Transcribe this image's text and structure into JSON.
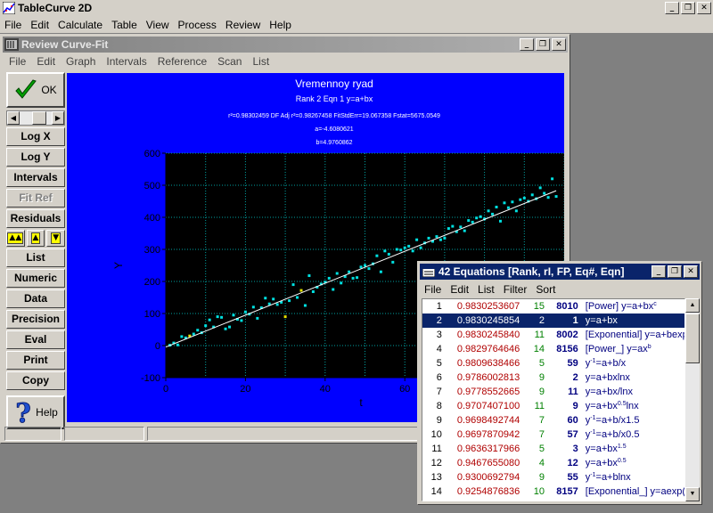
{
  "app": {
    "title": "TableCurve 2D"
  },
  "main_menu": [
    "File",
    "Edit",
    "Calculate",
    "Table",
    "View",
    "Process",
    "Review",
    "Help"
  ],
  "window_controls": {
    "minimize": "_",
    "restore": "❐",
    "close": "✕"
  },
  "review": {
    "title": "Review Curve-Fit",
    "menu": [
      "File",
      "Edit",
      "Graph",
      "Intervals",
      "Reference",
      "Scan",
      "List"
    ],
    "ok_label": "OK",
    "help_label": "Help",
    "buttons": [
      {
        "label": "Log X",
        "enabled": true
      },
      {
        "label": "Log Y",
        "enabled": true
      },
      {
        "label": "Intervals",
        "enabled": true
      },
      {
        "label": "Fit Ref",
        "enabled": false
      },
      {
        "label": "Residuals",
        "enabled": true
      }
    ],
    "buttons2": [
      {
        "label": "List"
      },
      {
        "label": "Numeric"
      },
      {
        "label": "Data"
      },
      {
        "label": "Precision"
      },
      {
        "label": "Eval"
      },
      {
        "label": "Print"
      },
      {
        "label": "Copy"
      }
    ],
    "tri_buttons": [
      "▲▲",
      "▲",
      "▼"
    ]
  },
  "colors": {
    "panel_bg": "#0000ff",
    "plot_bg": "#000000",
    "fit_line": "#ffffff",
    "points": "#00e0e0",
    "selected_row": "#0a246a"
  },
  "chart_data": {
    "type": "scatter",
    "title": "Vremennoy ryad",
    "subtitle": "Rank 2  Eqn 1  y=a+bx",
    "stats_line": "r²=0.98302459  DF Adj r²=0.98267458  FitStdErr=19.067358  Fstat=5675.0549",
    "param_a": "a=-4.6080621",
    "param_b": "b=4.9760862",
    "xlabel": "t",
    "ylabel": "Y",
    "xlim": [
      0,
      100
    ],
    "ylim": [
      -100,
      600
    ],
    "x_ticks": [
      "0",
      "20",
      "40",
      "60"
    ],
    "y_ticks": [
      "600",
      "500",
      "400",
      "300",
      "200",
      "100",
      "0",
      "-100"
    ],
    "grid": true,
    "fit": {
      "a": -4.6080621,
      "b": 4.9760862
    },
    "x": [
      1,
      2,
      3,
      4,
      5,
      6,
      7,
      8,
      9,
      10,
      11,
      12,
      13,
      14,
      15,
      16,
      17,
      18,
      19,
      20,
      21,
      22,
      23,
      24,
      25,
      26,
      27,
      28,
      29,
      30,
      31,
      32,
      33,
      34,
      35,
      36,
      37,
      38,
      39,
      40,
      41,
      42,
      43,
      44,
      45,
      46,
      47,
      48,
      49,
      50,
      51,
      52,
      53,
      54,
      55,
      56,
      57,
      58,
      59,
      60,
      61,
      62,
      63,
      64,
      65,
      66,
      67,
      68,
      69,
      70,
      71,
      72,
      73,
      74,
      75,
      76,
      77,
      78,
      79,
      80,
      81,
      82,
      83,
      84,
      85,
      86,
      87,
      88,
      89,
      90,
      91,
      92,
      93,
      94,
      95,
      96,
      97,
      98
    ],
    "y": [
      1,
      8,
      2,
      28,
      24,
      30,
      36,
      48,
      40,
      62,
      80,
      58,
      90,
      88,
      52,
      58,
      95,
      82,
      78,
      105,
      98,
      120,
      85,
      118,
      148,
      130,
      145,
      128,
      135,
      90,
      140,
      190,
      150,
      172,
      125,
      218,
      168,
      182,
      192,
      198,
      210,
      175,
      225,
      195,
      215,
      230,
      210,
      212,
      245,
      250,
      240,
      255,
      280,
      230,
      295,
      285,
      260,
      300,
      298,
      305,
      310,
      295,
      330,
      305,
      320,
      335,
      325,
      340,
      330,
      335,
      365,
      372,
      355,
      370,
      358,
      390,
      385,
      398,
      402,
      395,
      420,
      410,
      432,
      388,
      445,
      430,
      448,
      420,
      455,
      460,
      450,
      470,
      458,
      492,
      475,
      462,
      520,
      465
    ],
    "point_colors_note": "mostly cyan with a few yellow points"
  },
  "equations": {
    "title": "42 Equations  [Rank, rI, FP, Eq#, Eqn]",
    "menu": [
      "File",
      "Edit",
      "List",
      "Filter",
      "Sort"
    ],
    "rows": [
      {
        "n": "1",
        "r": "0.9830253607",
        "fp": "15",
        "eq": "8010",
        "pre": "[Power] y=a+bx",
        "sup": "c",
        "post": ""
      },
      {
        "n": "2",
        "r": "0.9830245854",
        "fp": "2",
        "eq": "1",
        "pre": "y=a+bx",
        "sup": "",
        "post": ""
      },
      {
        "n": "3",
        "r": "0.9830245840",
        "fp": "11",
        "eq": "8002",
        "pre": "[Exponential] y=a+bexp",
        "sup": "",
        "post": ""
      },
      {
        "n": "4",
        "r": "0.9829764646",
        "fp": "14",
        "eq": "8156",
        "pre": "[Power_] y=ax",
        "sup": "b",
        "post": ""
      },
      {
        "n": "5",
        "r": "0.9809638466",
        "fp": "5",
        "eq": "59",
        "pre": "y",
        "sup": "-1",
        "post": "=a+b/x"
      },
      {
        "n": "6",
        "r": "0.9786002813",
        "fp": "9",
        "eq": "2",
        "pre": "y=a+bxlnx",
        "sup": "",
        "post": ""
      },
      {
        "n": "7",
        "r": "0.9778552665",
        "fp": "9",
        "eq": "11",
        "pre": "y=a+bx/lnx",
        "sup": "",
        "post": ""
      },
      {
        "n": "8",
        "r": "0.9707407100",
        "fp": "11",
        "eq": "9",
        "pre": "y=a+bx",
        "sup": "0.5",
        "post": "lnx"
      },
      {
        "n": "9",
        "r": "0.9698492744",
        "fp": "7",
        "eq": "60",
        "pre": "y",
        "sup": "-1",
        "post": "=a+b/x1.5"
      },
      {
        "n": "10",
        "r": "0.9697870942",
        "fp": "7",
        "eq": "57",
        "pre": "y",
        "sup": "-1",
        "post": "=a+b/x0.5"
      },
      {
        "n": "11",
        "r": "0.9636317966",
        "fp": "5",
        "eq": "3",
        "pre": "y=a+bx",
        "sup": "1.5",
        "post": ""
      },
      {
        "n": "12",
        "r": "0.9467655080",
        "fp": "4",
        "eq": "12",
        "pre": "y=a+bx",
        "sup": "0.5",
        "post": ""
      },
      {
        "n": "13",
        "r": "0.9300692794",
        "fp": "9",
        "eq": "55",
        "pre": "y",
        "sup": "-1",
        "post": "=a+blnx"
      },
      {
        "n": "14",
        "r": "0.9254876836",
        "fp": "10",
        "eq": "8157",
        "pre": "[Exponential_] y=aexp(",
        "sup": "",
        "post": ""
      }
    ],
    "selected_index": 1
  }
}
